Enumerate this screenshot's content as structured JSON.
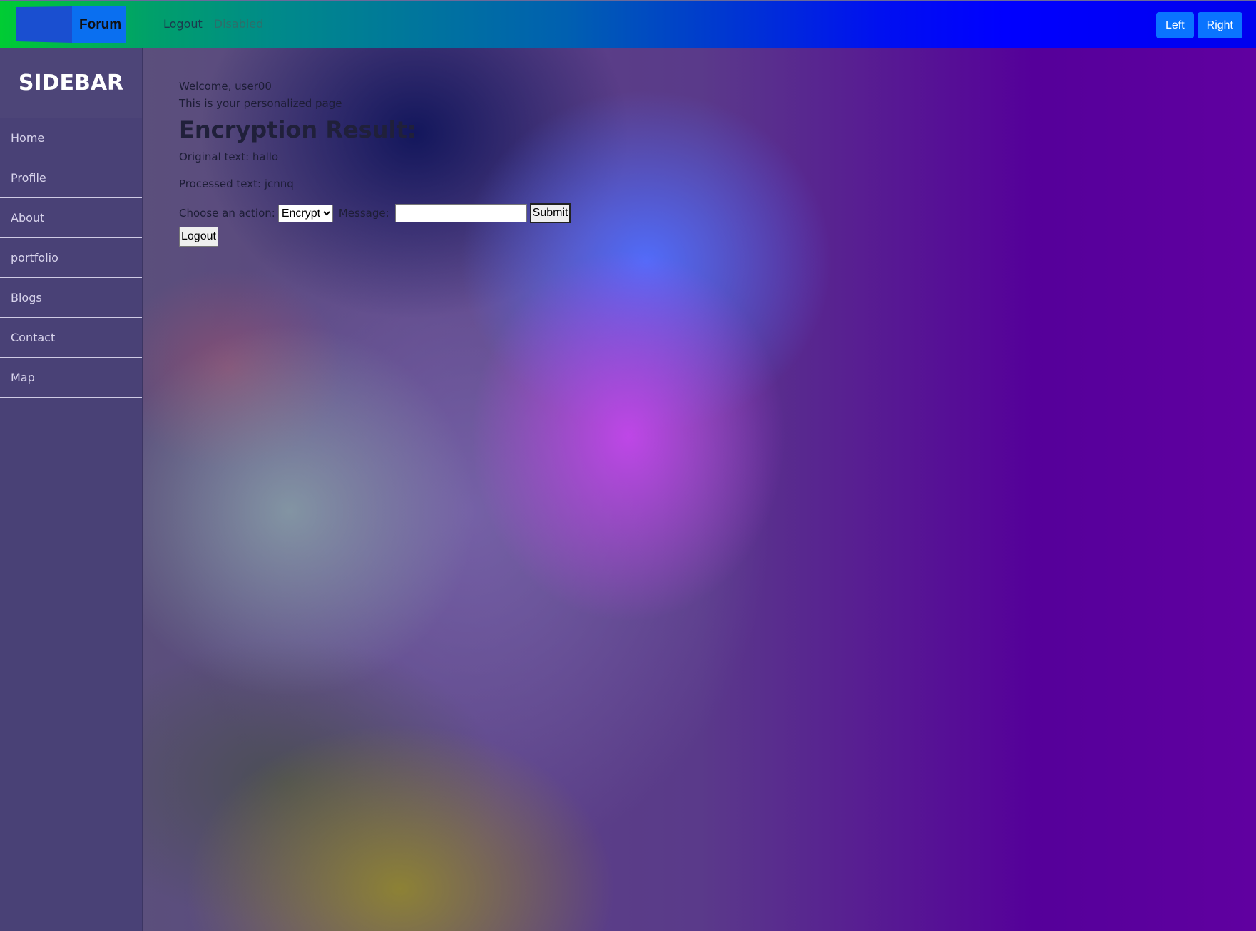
{
  "navbar": {
    "brand_label": "Forum",
    "links": {
      "logout": "Logout",
      "disabled": "Disabled"
    },
    "buttons": {
      "left": "Left",
      "right": "Right"
    },
    "colors": {
      "gradient_start": "#00cc33",
      "gradient_end": "#0000ff",
      "button": "#0a74ff"
    }
  },
  "sidebar": {
    "title": "SIDEBAR",
    "items": [
      {
        "label": "Home"
      },
      {
        "label": "Profile"
      },
      {
        "label": "About"
      },
      {
        "label": "portfolio"
      },
      {
        "label": "Blogs"
      },
      {
        "label": "Contact"
      },
      {
        "label": "Map"
      }
    ]
  },
  "main": {
    "welcome": "Welcome, user00",
    "subtitle": "This is your personalized page",
    "result_title": "Encryption Result:",
    "original_text": "Original text: hallo",
    "processed_text": "Processed text: jcnnq",
    "form": {
      "action_label": "Choose an action:",
      "action_selected": "Encrypt",
      "message_label": "Message:",
      "message_value": "",
      "submit_label": "Submit"
    },
    "logout_label": "Logout"
  }
}
